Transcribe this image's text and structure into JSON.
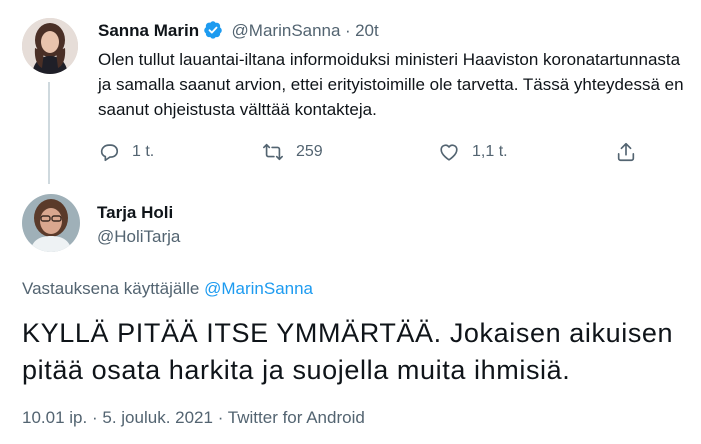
{
  "tweet1": {
    "name": "Sanna Marin",
    "handle": "@MarinSanna",
    "sep": "·",
    "time": "20t",
    "text": "Olen tullut lauantai-iltana informoiduksi ministeri Haaviston koronatartunnasta ja samalla saanut arvion, ettei erityistoimille ole tarvetta. Tässä yhteydessä en saanut ohjeistusta välttää kontakteja.",
    "reply_count": "1 t.",
    "retweet_count": "259",
    "like_count": "1,1 t."
  },
  "tweet2": {
    "name": "Tarja Holi",
    "handle": "@HoliTarja",
    "reply_prefix": "Vastauksena käyttäjälle",
    "reply_to": "@MarinSanna",
    "text": "KYLLÄ PITÄÄ ITSE YMMÄRTÄÄ.  Jokaisen aikuisen pitää osata harkita ja suojella muita ihmisiä.",
    "time": "10.01 ip.",
    "date": "5. jouluk. 2021",
    "source": "Twitter for Android",
    "sep": "·"
  },
  "colors": {
    "accent": "#1d9bf0",
    "text": "#0f1419",
    "muted": "#536471",
    "line": "#cfd9de"
  }
}
